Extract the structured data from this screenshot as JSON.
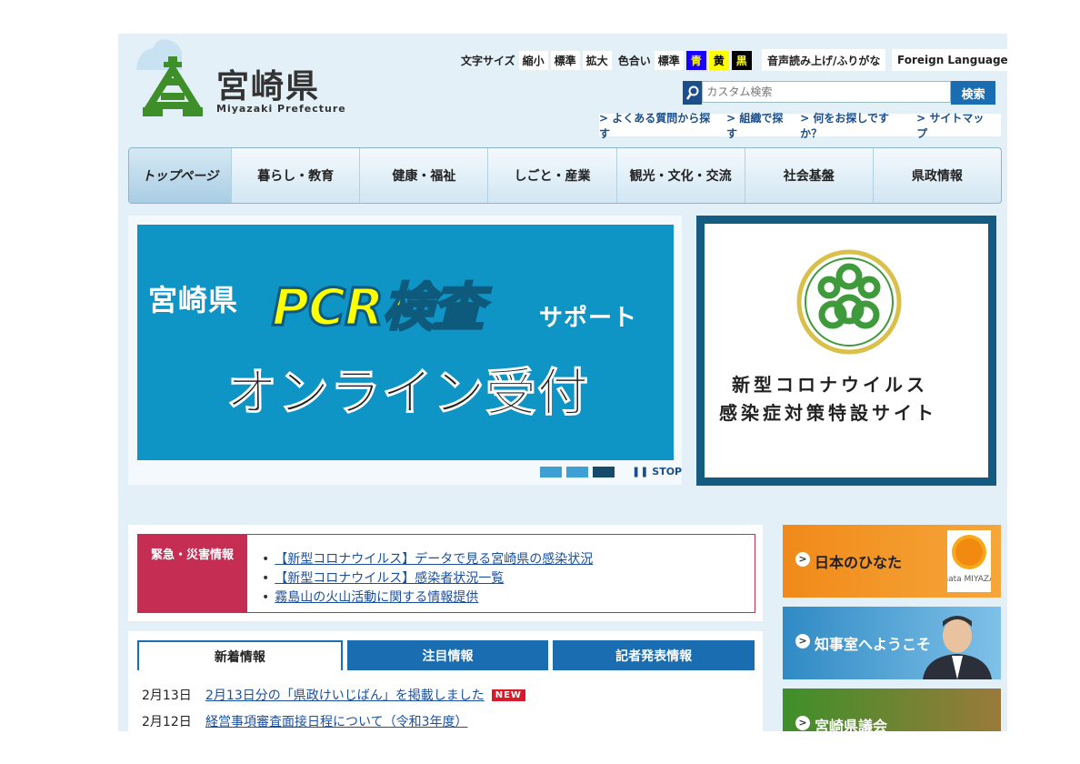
{
  "header": {
    "logo_title": "宮崎県",
    "logo_sub": "Miyazaki Prefecture",
    "font_size_label": "文字サイズ",
    "font_small": "縮小",
    "font_normal": "標準",
    "font_large": "拡大",
    "color_label": "色合い",
    "color_normal": "標準",
    "color_blue": "青",
    "color_yellow": "黄",
    "color_black": "黒",
    "speech": "音声読み上げ/ふりがな",
    "foreign": "Foreign Language",
    "search_placeholder": "カスタム検索",
    "search_button": "検索",
    "quick_links": [
      "よくある質問から探す",
      "組織で探す",
      "何をお探しですか？",
      "サイトマップ"
    ]
  },
  "nav": {
    "items": [
      "トップページ",
      "暮らし・教育",
      "健康・福祉",
      "しごと・産業",
      "観光・文化・交流",
      "社会基盤",
      "県政情報"
    ]
  },
  "banner": {
    "line1": "宮崎県",
    "pcr": "PCR検査",
    "support": "サポート",
    "line2": "オンライン受付",
    "stop": "STOP"
  },
  "covid": {
    "line1": "新型コロナウイルス",
    "line2": "感染症対策特設サイト"
  },
  "emergency": {
    "label": "緊急・災害情報",
    "items": [
      "【新型コロナウイルス】データで見る宮崎県の感染状況",
      "【新型コロナウイルス】感染者状況一覧",
      "霧島山の火山活動に関する情報提供"
    ]
  },
  "news": {
    "tabs": [
      "新着情報",
      "注目情報",
      "記者発表情報"
    ],
    "rows": [
      {
        "date": "2月13日",
        "title": "2月13日分の「県政けいじばん」を掲載しました",
        "badge": "NEW"
      },
      {
        "date": "2月12日",
        "title": "経営事項審査面接日程について（令和3年度）"
      }
    ]
  },
  "side": {
    "hinata": "日本のひなた",
    "hinata_logo": "hinata MIYAZAKI",
    "governor": "知事室へようこそ",
    "assembly": "宮崎県議会"
  },
  "colors": {
    "accent": "#1a6db0",
    "emergency": "#c52d52",
    "banner_bg": "#0f94c6"
  }
}
